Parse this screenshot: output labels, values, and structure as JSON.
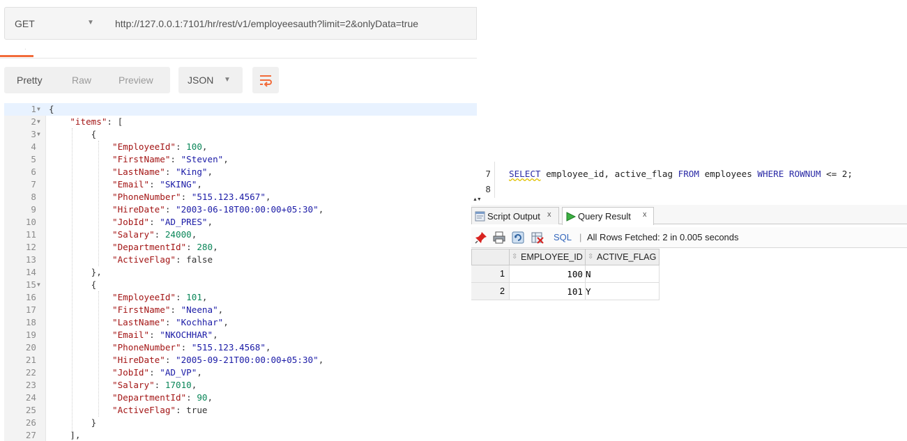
{
  "postman": {
    "method": "GET",
    "url": "http://127.0.0.1:7101/hr/rest/v1/employeesauth?limit=2&onlyData=true",
    "formats": [
      "Pretty",
      "Raw",
      "Preview"
    ],
    "language": "JSON",
    "accent_color": "#f26b3a",
    "line_numbers": [
      "1",
      "2",
      "3",
      "4",
      "5",
      "6",
      "7",
      "8",
      "9",
      "10",
      "11",
      "12",
      "13",
      "14",
      "15",
      "16",
      "17",
      "18",
      "19",
      "20",
      "21",
      "22",
      "23",
      "24",
      "25",
      "26",
      "27"
    ],
    "lines": [
      {
        "t": "{",
        "k": "",
        "v": "",
        "vt": ""
      },
      {
        "t": "    ",
        "k": "\"items\"",
        "v": "[",
        "vt": "p"
      },
      {
        "t": "        {",
        "k": "",
        "v": "",
        "vt": ""
      },
      {
        "t": "            ",
        "k": "\"EmployeeId\"",
        "v": "100",
        "vt": "n",
        "c": ","
      },
      {
        "t": "            ",
        "k": "\"FirstName\"",
        "v": "\"Steven\"",
        "vt": "s",
        "c": ","
      },
      {
        "t": "            ",
        "k": "\"LastName\"",
        "v": "\"King\"",
        "vt": "s",
        "c": ","
      },
      {
        "t": "            ",
        "k": "\"Email\"",
        "v": "\"SKING\"",
        "vt": "s",
        "c": ","
      },
      {
        "t": "            ",
        "k": "\"PhoneNumber\"",
        "v": "\"515.123.4567\"",
        "vt": "s",
        "c": ","
      },
      {
        "t": "            ",
        "k": "\"HireDate\"",
        "v": "\"2003-06-18T00:00:00+05:30\"",
        "vt": "s",
        "c": ","
      },
      {
        "t": "            ",
        "k": "\"JobId\"",
        "v": "\"AD_PRES\"",
        "vt": "s",
        "c": ","
      },
      {
        "t": "            ",
        "k": "\"Salary\"",
        "v": "24000",
        "vt": "n",
        "c": ","
      },
      {
        "t": "            ",
        "k": "\"DepartmentId\"",
        "v": "280",
        "vt": "n",
        "c": ","
      },
      {
        "t": "            ",
        "k": "\"ActiveFlag\"",
        "v": "false",
        "vt": "p",
        "c": ""
      },
      {
        "t": "        },",
        "k": "",
        "v": "",
        "vt": ""
      },
      {
        "t": "        {",
        "k": "",
        "v": "",
        "vt": ""
      },
      {
        "t": "            ",
        "k": "\"EmployeeId\"",
        "v": "101",
        "vt": "n",
        "c": ","
      },
      {
        "t": "            ",
        "k": "\"FirstName\"",
        "v": "\"Neena\"",
        "vt": "s",
        "c": ","
      },
      {
        "t": "            ",
        "k": "\"LastName\"",
        "v": "\"Kochhar\"",
        "vt": "s",
        "c": ","
      },
      {
        "t": "            ",
        "k": "\"Email\"",
        "v": "\"NKOCHHAR\"",
        "vt": "s",
        "c": ","
      },
      {
        "t": "            ",
        "k": "\"PhoneNumber\"",
        "v": "\"515.123.4568\"",
        "vt": "s",
        "c": ","
      },
      {
        "t": "            ",
        "k": "\"HireDate\"",
        "v": "\"2005-09-21T00:00:00+05:30\"",
        "vt": "s",
        "c": ","
      },
      {
        "t": "            ",
        "k": "\"JobId\"",
        "v": "\"AD_VP\"",
        "vt": "s",
        "c": ","
      },
      {
        "t": "            ",
        "k": "\"Salary\"",
        "v": "17010",
        "vt": "n",
        "c": ","
      },
      {
        "t": "            ",
        "k": "\"DepartmentId\"",
        "v": "90",
        "vt": "n",
        "c": ","
      },
      {
        "t": "            ",
        "k": "\"ActiveFlag\"",
        "v": "true",
        "vt": "p",
        "c": ""
      },
      {
        "t": "        }",
        "k": "",
        "v": "",
        "vt": ""
      },
      {
        "t": "    ],",
        "k": "",
        "v": "",
        "vt": ""
      }
    ],
    "foldable_lines": [
      1,
      2,
      3,
      15
    ]
  },
  "sqldev": {
    "line_numbers": [
      "7",
      "8"
    ],
    "sql": {
      "select": "SELECT",
      "cols": " employee_id, active_flag ",
      "from": "FROM",
      "table": " employees ",
      "where": "WHERE",
      "sp": " ",
      "rownum": "ROWNUM",
      "rest": " <= 2;"
    },
    "tabs": [
      {
        "label": "Script Output",
        "close": "x"
      },
      {
        "label": "Query Result",
        "close": "x"
      }
    ],
    "toolbar": {
      "sql_link": "SQL",
      "separator": "|",
      "status": "All Rows Fetched: 2 in 0.005 seconds"
    },
    "grid": {
      "columns": [
        "EMPLOYEE_ID",
        "ACTIVE_FLAG"
      ],
      "rows": [
        {
          "num": "1",
          "employee_id": "100",
          "active_flag": "N"
        },
        {
          "num": "2",
          "employee_id": "101",
          "active_flag": "Y"
        }
      ]
    }
  }
}
